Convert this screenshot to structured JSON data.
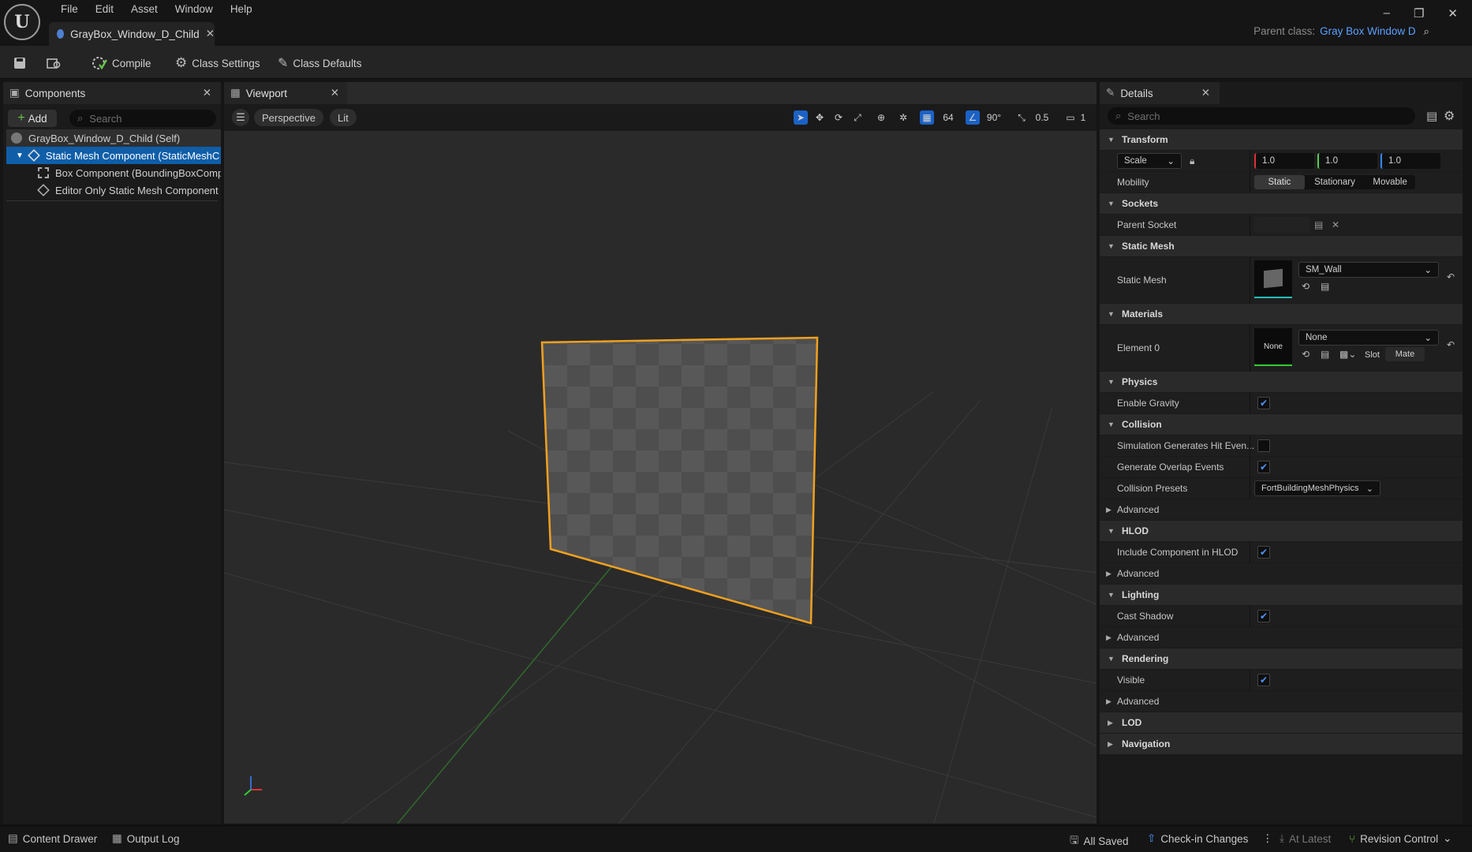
{
  "menu": [
    "File",
    "Edit",
    "Asset",
    "Window",
    "Help"
  ],
  "document_tab": "GrayBox_Window_D_Child",
  "parent_class_label": "Parent class:",
  "parent_class_value": "Gray Box Window D",
  "toolbar": {
    "compile": "Compile",
    "class_settings": "Class Settings",
    "class_defaults": "Class Defaults"
  },
  "components": {
    "tab": "Components",
    "add": "Add",
    "search_placeholder": "Search",
    "tree": [
      "GrayBox_Window_D_Child (Self)",
      "Static Mesh Component (StaticMeshC",
      "Box Component (BoundingBoxComp",
      "Editor Only Static Mesh Component ("
    ]
  },
  "viewport": {
    "tab": "Viewport",
    "perspective": "Perspective",
    "lit": "Lit",
    "grid_snap": "64",
    "rot_snap": "90°",
    "scale_snap": "0.5",
    "camera_speed": "1"
  },
  "details": {
    "tab": "Details",
    "search_placeholder": "Search",
    "transform": "Transform",
    "scale_label": "Scale",
    "scale": [
      "1.0",
      "1.0",
      "1.0"
    ],
    "mobility": "Mobility",
    "mobility_options": [
      "Static",
      "Stationary",
      "Movable"
    ],
    "sockets": "Sockets",
    "parent_socket": "Parent Socket",
    "static_mesh_section": "Static Mesh",
    "static_mesh_label": "Static Mesh",
    "static_mesh_value": "SM_Wall",
    "materials": "Materials",
    "element0": "Element 0",
    "element0_thumb": "None",
    "element0_value": "None",
    "slot": "Slot",
    "mate": "Mate",
    "physics": "Physics",
    "enable_gravity": "Enable Gravity",
    "collision": "Collision",
    "sim_hit": "Simulation Generates Hit Even...",
    "gen_overlap": "Generate Overlap Events",
    "collision_presets": "Collision Presets",
    "collision_presets_value": "FortBuildingMeshPhysics",
    "advanced": "Advanced",
    "hlod": "HLOD",
    "include_hlod": "Include Component in HLOD",
    "lighting": "Lighting",
    "cast_shadow": "Cast Shadow",
    "rendering": "Rendering",
    "visible": "Visible",
    "lod": "LOD",
    "navigation": "Navigation"
  },
  "status": {
    "content_drawer": "Content Drawer",
    "output_log": "Output Log",
    "all_saved": "All Saved",
    "check_in": "Check-in Changes",
    "at_latest": "At Latest",
    "revision_control": "Revision Control"
  },
  "colors": {
    "accent": "#4e94ff",
    "selection": "#f0a020",
    "link": "#5aa0ff"
  }
}
